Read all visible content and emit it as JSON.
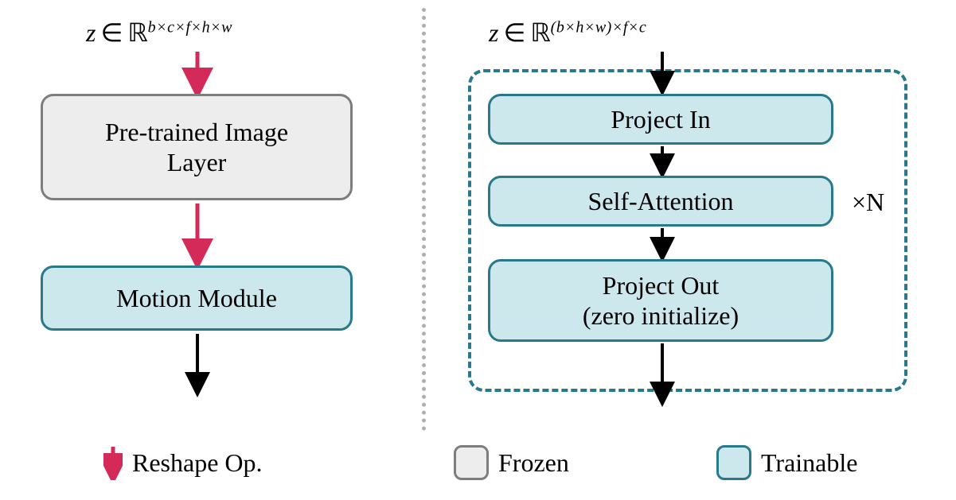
{
  "left": {
    "formula_html": "<span class='z'>z</span><span class='in'>∈</span><span class='bb'>ℝ</span><sup>b×c×f×h×w</sup>",
    "pretrained_label": "Pre-trained Image<br>Layer",
    "motion_label": "Motion Module"
  },
  "right": {
    "formula_html": "<span class='z'>z</span><span class='in'>∈</span><span class='bb'>ℝ</span><sup>(b×h×w)×f×c</sup>",
    "project_in": "Project In",
    "self_attention": "Self-Attention",
    "project_out": "Project Out<br>(zero initialize)",
    "xn_label": "×N"
  },
  "legend": {
    "reshape": "Reshape Op.",
    "frozen": "Frozen",
    "trainable": "Trainable"
  },
  "colors": {
    "red": "#d42a5a",
    "teal": "#28798a",
    "black": "#000000"
  }
}
